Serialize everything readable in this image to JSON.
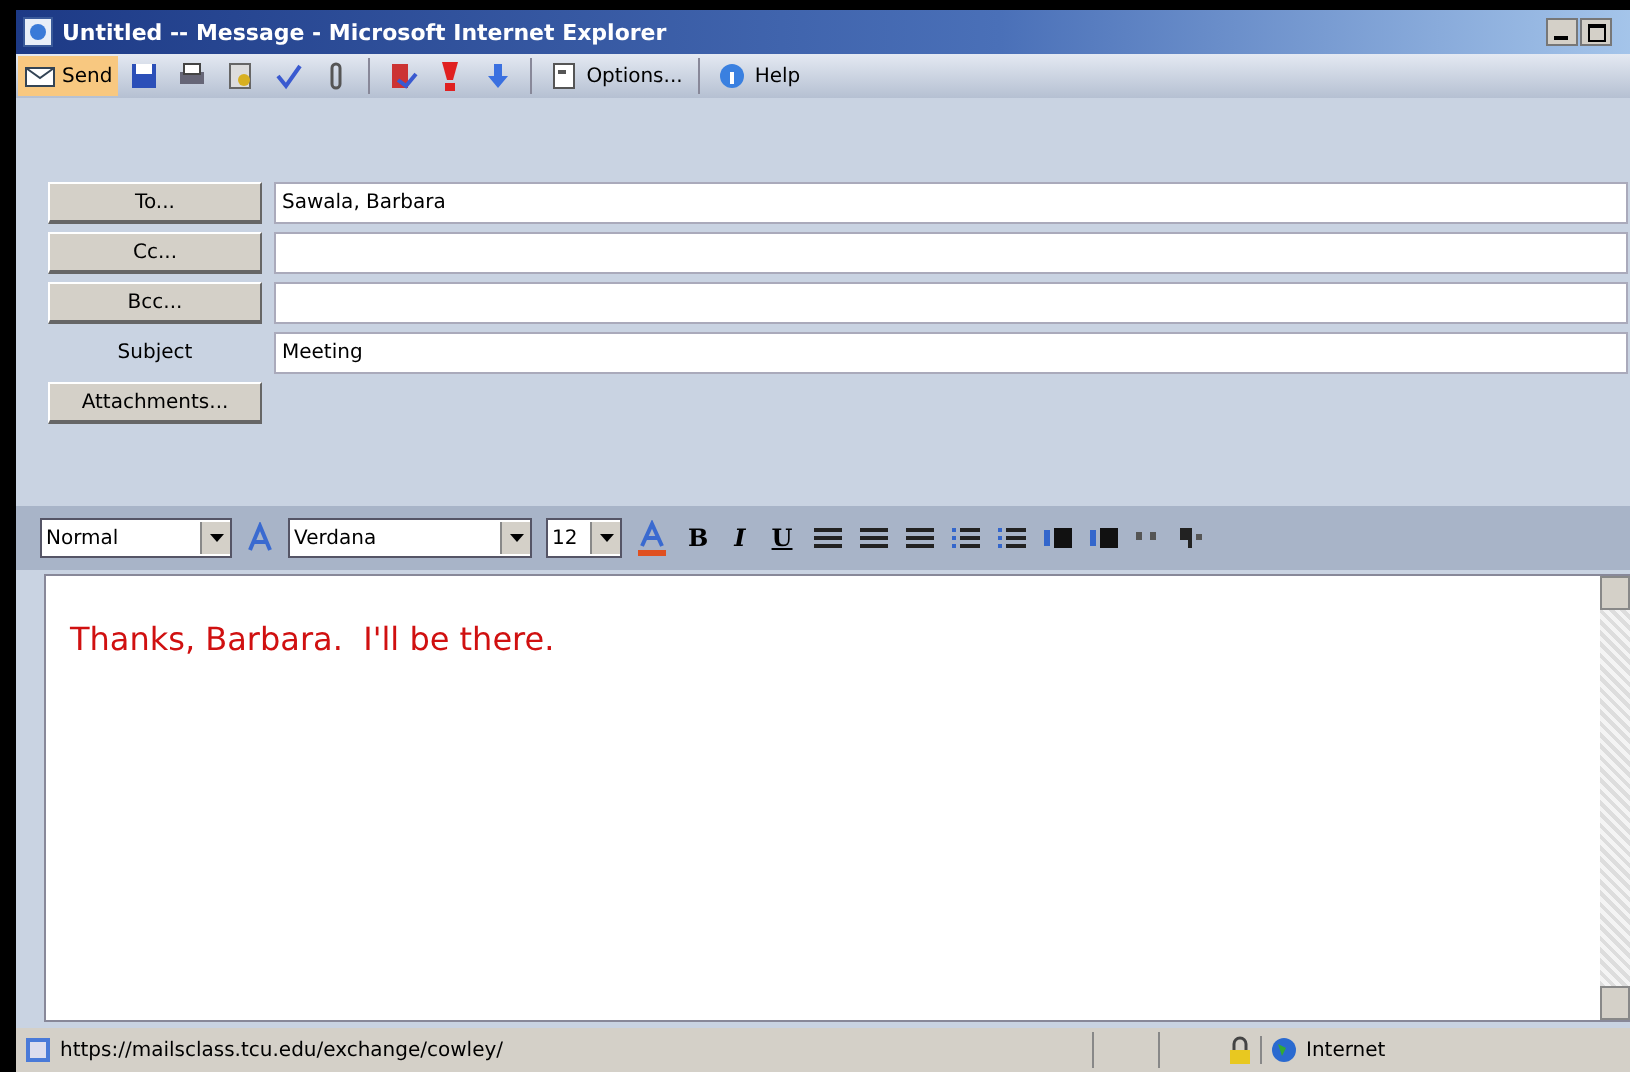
{
  "window": {
    "title": "Untitled -- Message - Microsoft Internet Explorer"
  },
  "toolbar": {
    "items": [
      {
        "kind": "send",
        "label": "Send",
        "selected": true
      },
      {
        "kind": "save"
      },
      {
        "kind": "print"
      },
      {
        "kind": "address"
      },
      {
        "kind": "spell"
      },
      {
        "kind": "attach"
      },
      {
        "kind": "check"
      },
      {
        "kind": "important"
      },
      {
        "kind": "low"
      },
      {
        "kind": "options",
        "label": "Options..."
      },
      {
        "kind": "help",
        "label": "Help"
      }
    ]
  },
  "header": {
    "fields": [
      {
        "kind": "button",
        "label": "To...",
        "value": "Sawala, Barbara"
      },
      {
        "kind": "button",
        "label": "Cc..."
      },
      {
        "kind": "button",
        "label": "Bcc..."
      },
      {
        "kind": "text",
        "label": "Subject",
        "value": "Meeting"
      }
    ],
    "attachments_button": "Attachments..."
  },
  "format": {
    "style": "Normal",
    "font": "Verdana",
    "size": "12",
    "buttons": [
      "B",
      "I",
      "U"
    ]
  },
  "body": {
    "text": "Thanks, Barbara.  I'll be there."
  },
  "status_bar": {
    "url": "https://mailsclass.tcu.edu/exchange/cowley/",
    "zone": "Internet"
  }
}
